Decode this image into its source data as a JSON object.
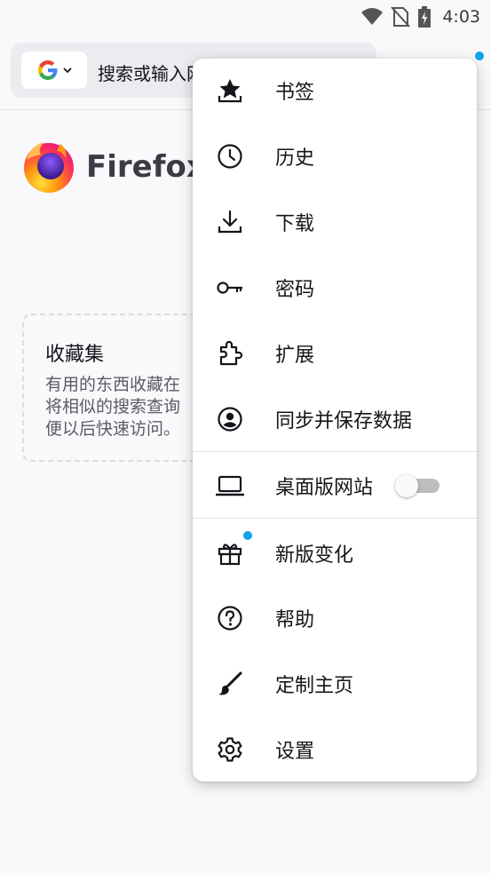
{
  "status_bar": {
    "time": "4:03",
    "icons": [
      "wifi-icon",
      "no-sim-icon",
      "battery-charging-icon"
    ]
  },
  "toolbar": {
    "search_engine": "google",
    "search_engine_icon": "google-icon",
    "url_placeholder": "搜索或输入网址"
  },
  "home": {
    "brand": "Firefox",
    "collections": {
      "title": "收藏集",
      "description_lines": [
        "有用的东西收藏在",
        "将相似的搜索查询",
        "便以后快速访问。"
      ]
    }
  },
  "menu": {
    "items_group1": [
      {
        "label": "书签",
        "icon": "bookmark-star-icon"
      },
      {
        "label": "历史",
        "icon": "clock-icon"
      },
      {
        "label": "下载",
        "icon": "download-icon"
      },
      {
        "label": "密码",
        "icon": "key-icon"
      },
      {
        "label": "扩展",
        "icon": "extensions-icon"
      },
      {
        "label": "同步并保存数据",
        "icon": "account-icon"
      }
    ],
    "desktop_site": {
      "label": "桌面版网站",
      "icon": "laptop-icon",
      "enabled": false
    },
    "items_group3": [
      {
        "label": "新版变化",
        "icon": "gift-icon",
        "badge": true
      },
      {
        "label": "帮助",
        "icon": "help-icon"
      },
      {
        "label": "定制主页",
        "icon": "brush-icon"
      },
      {
        "label": "设置",
        "icon": "gear-icon"
      }
    ]
  },
  "colors": {
    "accent_dot": "#0ea5e9",
    "background": "#f9f9fb",
    "text": "#15141a"
  }
}
